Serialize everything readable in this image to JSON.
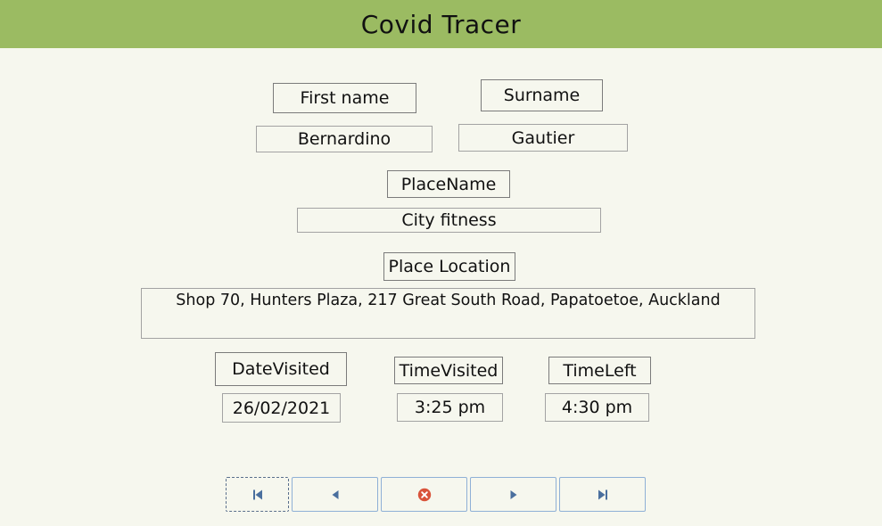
{
  "header": {
    "title": "Covid Tracer"
  },
  "labels": {
    "first_name": "First name",
    "surname": "Surname",
    "place_name": "PlaceName",
    "place_location": "Place Location",
    "date_visited": "DateVisited",
    "time_visited": "TimeVisited",
    "time_left": "TimeLeft"
  },
  "record": {
    "first_name": "Bernardino",
    "surname": "Gautier",
    "place_name": "City fitness",
    "place_location": "Shop 70, Hunters Plaza, 217 Great South Road, Papatoetoe, Auckland",
    "date_visited": "26/02/2021",
    "time_visited": "3:25 pm",
    "time_left": "4:30 pm"
  },
  "navigation": {
    "buttons": [
      {
        "name": "first-record",
        "icon": "first-record-icon"
      },
      {
        "name": "previous-record",
        "icon": "previous-record-icon"
      },
      {
        "name": "delete-record",
        "icon": "delete-icon"
      },
      {
        "name": "next-record",
        "icon": "next-record-icon"
      },
      {
        "name": "last-record",
        "icon": "last-record-icon"
      }
    ]
  },
  "colors": {
    "header_bg": "#9bbb62",
    "page_bg": "#f6f7ee",
    "nav_icon": "#4a6f9e",
    "delete_icon": "#d9533a"
  }
}
